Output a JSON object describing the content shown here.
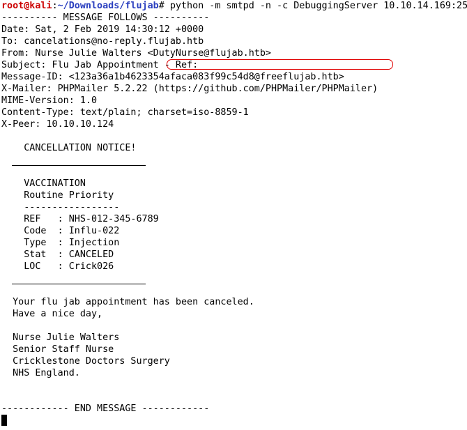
{
  "prompt": {
    "user": "root@kali",
    "sep": ":",
    "path": "~/Downloads/flujab",
    "symbol": "# ",
    "command": "python -m smtpd -n -c DebuggingServer 10.10.14.169:25"
  },
  "header_lines": [
    "---------- MESSAGE FOLLOWS ----------",
    "Date: Sat, 2 Feb 2019 14:30:12 +0000",
    "To: cancelations@no-reply.flujab.htb",
    "From: Nurse Julie Walters <DutyNurse@flujab.htb>",
    "Subject: Flu Jab Appointment - Ref:",
    "Message-ID: <123a36a1b4623354afaca083f99c54d8@freeflujab.htb>",
    "X-Mailer: PHPMailer 5.2.22 (https://github.com/PHPMailer/PHPMailer)",
    "MIME-Version: 1.0",
    "Content-Type: text/plain; charset=iso-8859-1",
    "X-Peer: 10.10.10.124"
  ],
  "notice_title": "CANCELLATION NOTICE!",
  "section": {
    "heading": "VACCINATION",
    "priority": "Routine Priority",
    "divider": "-----------------",
    "fields": [
      {
        "key": "REF   ",
        "value": "NHS-012-345-6789"
      },
      {
        "key": "Code  ",
        "value": "Influ-022"
      },
      {
        "key": "Type  ",
        "value": "Injection"
      },
      {
        "key": "Stat  ",
        "value": "CANCELED"
      },
      {
        "key": "LOC   ",
        "value": "Crick026"
      }
    ]
  },
  "message": {
    "line1": "Your flu jab appointment has been canceled.",
    "line2": "Have a nice day,"
  },
  "signature": [
    "Nurse Julie Walters",
    "Senior Staff Nurse",
    "Cricklestone Doctors Surgery",
    "NHS England."
  ],
  "end_line": "------------ END MESSAGE ------------",
  "colors": {
    "user": "#cc0000",
    "path": "#2a3fbf",
    "highlight": "#e00000"
  }
}
